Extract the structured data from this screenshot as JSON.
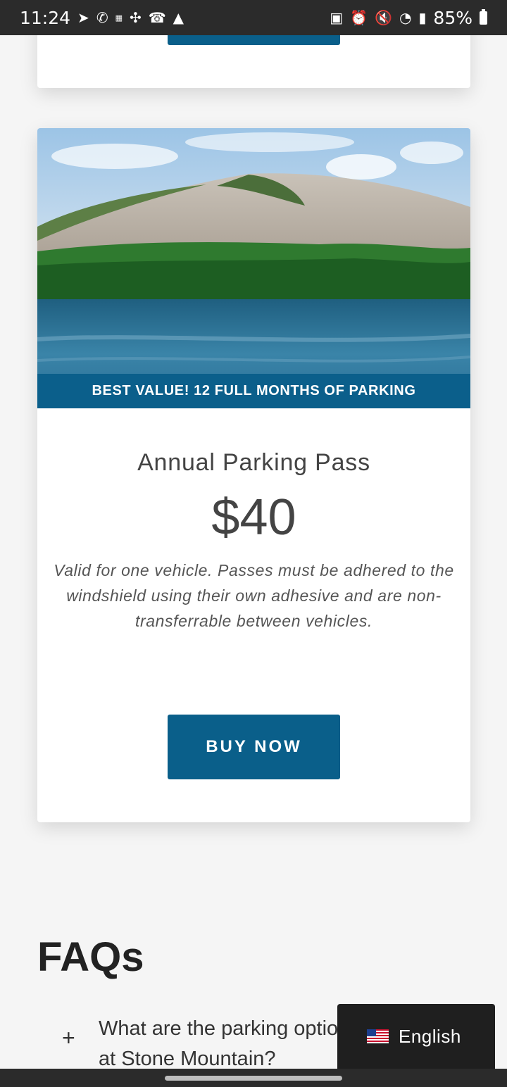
{
  "status_bar": {
    "time": "11:24",
    "battery": "85%",
    "left_icons": [
      "telegram-icon",
      "whatsapp-icon",
      "temu-icon",
      "fan-icon",
      "missed-call-icon",
      "warning-icon"
    ],
    "right_icons": [
      "battery-saver-icon",
      "alarm-icon",
      "mute-icon",
      "wifi-icon",
      "signal-icon"
    ]
  },
  "product": {
    "banner": "BEST VALUE! 12 FULL MONTHS OF PARKING",
    "title": "Annual Parking Pass",
    "price": "$40",
    "description": "Valid for one vehicle. Passes must be adhered to the windshield using their own adhesive and are non-transferrable between vehicles.",
    "button_label": "BUY NOW"
  },
  "faq": {
    "title": "FAQs",
    "items": [
      {
        "question": "What are the parking options available at Stone Mountain?"
      }
    ]
  },
  "language": {
    "label": "English"
  },
  "colors": {
    "brand_blue": "#0a5f8a",
    "status_bar": "#2b2b2b",
    "lang_widget": "#1f1f1f"
  }
}
